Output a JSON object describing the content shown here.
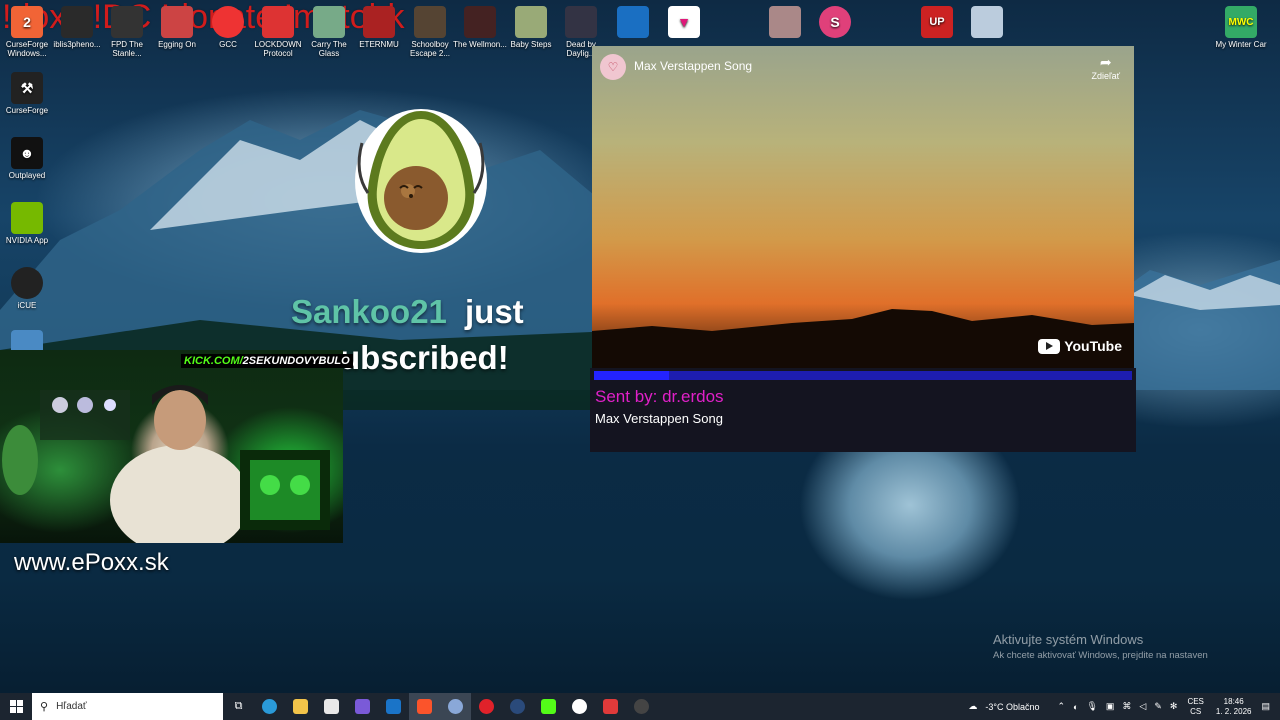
{
  "overlay_commands": "!doxx !DC !donate !matobk",
  "desktop_icons": [
    {
      "label": "CurseForge Windows...",
      "icon": "curseforge-icon",
      "color": "#f16436"
    },
    {
      "label": "iblis3pheno...",
      "icon": "game-icon",
      "color": "#2a2a2a"
    },
    {
      "label": "FPD The Stanle...",
      "icon": "game-icon",
      "color": "#333"
    },
    {
      "label": "Egging On",
      "icon": "egg-icon",
      "color": "#c44"
    },
    {
      "label": "GCC",
      "icon": "chrome-icon",
      "color": "#e33"
    },
    {
      "label": "LOCKDOWN Protocol",
      "icon": "game-icon",
      "color": "#d33"
    },
    {
      "label": "Carry The Glass",
      "icon": "game-icon",
      "color": "#7a8"
    },
    {
      "label": "ETERNMU",
      "icon": "game-icon",
      "color": "#a22"
    },
    {
      "label": "Schoolboy Escape 2...",
      "icon": "game-icon",
      "color": "#543"
    },
    {
      "label": "The Wellmon...",
      "icon": "game-icon",
      "color": "#422"
    },
    {
      "label": "Baby Steps",
      "icon": "game-icon",
      "color": "#9a7"
    },
    {
      "label": "Dead by Daylig...",
      "icon": "game-icon",
      "color": "#334"
    },
    {
      "label": "CurseForge",
      "icon": "curseforge-icon",
      "color": "#222"
    },
    {
      "label": "Outplayed",
      "icon": "outplayed-icon",
      "color": "#111"
    },
    {
      "label": "NVIDIA App",
      "icon": "nvidia-icon",
      "color": "#76b900"
    },
    {
      "label": "iCUE",
      "icon": "icue-icon",
      "color": "#222"
    },
    {
      "label": "My Winter Car",
      "icon": "game-icon",
      "color": "#3a6"
    }
  ],
  "alert": {
    "username": "Sankoo21",
    "line1_rest": "just",
    "line2": "ubscribed!"
  },
  "webcam": {
    "kick_tag_prefix": "KICK.COM/",
    "kick_tag_channel": "2SEKUNDOVYBULO"
  },
  "website": "www.ePoxx.sk",
  "video": {
    "title": "Max Verstappen Song",
    "share_label": "Zdieľať",
    "youtube_label": "YouTube",
    "progress": 0.14
  },
  "song_request": {
    "sent_by": "Sent by: dr.erdos",
    "song_title": "Max Verstappen Song"
  },
  "windows_activation": {
    "title": "Aktivujte systém Windows",
    "subtitle": "Ak chcete aktivovať Windows, prejdite na nastaven"
  },
  "taskbar": {
    "search_placeholder": "Hľadať",
    "weather": "-3°C  Oblačno",
    "lang_top": "CES",
    "lang_bottom": "CS",
    "time": "18:46",
    "date": "1. 2. 2026"
  }
}
